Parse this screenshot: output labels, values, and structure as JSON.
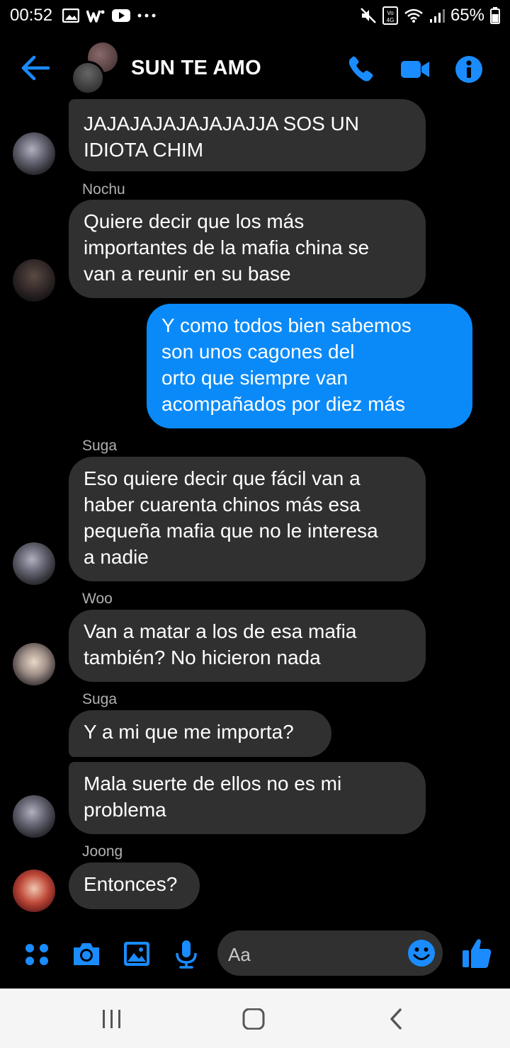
{
  "status_bar": {
    "time": "00:52",
    "battery": "65%",
    "icons_left": [
      "gallery-icon",
      "w-app-icon",
      "youtube-icon",
      "more-dots-icon"
    ],
    "icons_right": [
      "mute-icon",
      "volte-4g-icon",
      "wifi-icon",
      "signal-icon",
      "battery-icon"
    ]
  },
  "header": {
    "title": "SUN TE AMO",
    "accent_color": "#0a8af8"
  },
  "messages": [
    {
      "sender": "",
      "text": "JAJAJAJAJAJAJAJJA SOS UN\nIDIOTA CHIM",
      "mine": false,
      "avatar": "suga"
    },
    {
      "sender": "Nochu",
      "text": "Quiere decir que los más\nimportantes de la mafia china se\nvan a reunir en su base",
      "mine": false,
      "avatar": "nochu"
    },
    {
      "sender": "",
      "text": "Y como todos bien sabemos\nson unos cagones del\norto que siempre van\nacompañados por diez más",
      "mine": true
    },
    {
      "sender": "Suga",
      "text": "Eso quiere decir que fácil van a\nhaber cuarenta chinos más esa\npequeña mafia que no le interesa\na nadie",
      "mine": false,
      "avatar": "suga"
    },
    {
      "sender": "Woo",
      "text": "Van a matar a los de esa mafia\ntambién? No hicieron nada",
      "mine": false,
      "avatar": "woo"
    },
    {
      "sender": "Suga",
      "text": "Y a mi que me importa?",
      "mine": false
    },
    {
      "sender": "",
      "text": "Mala suerte de ellos no es mi\nproblema",
      "mine": false,
      "avatar": "suga"
    },
    {
      "sender": "Joong",
      "text": "Entonces?",
      "mine": false,
      "avatar": "joong"
    }
  ],
  "composer": {
    "placeholder": "Aa"
  }
}
